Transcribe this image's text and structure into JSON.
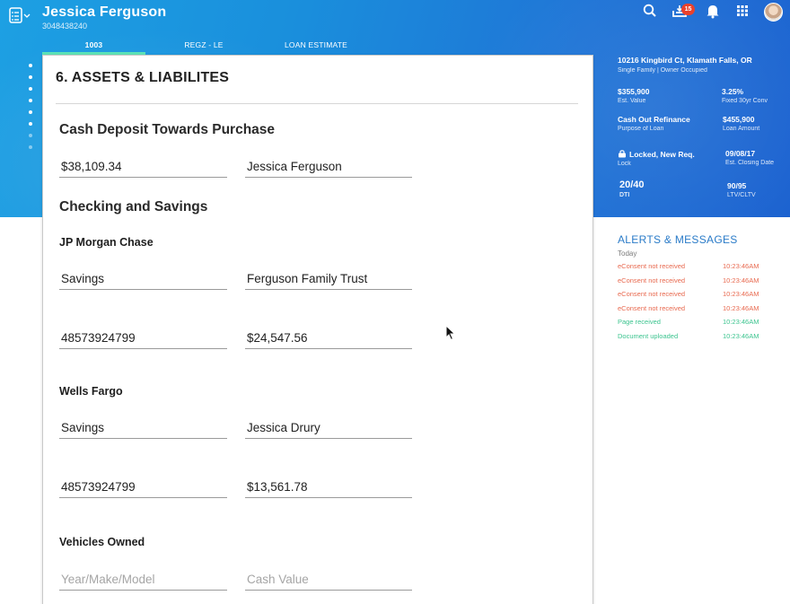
{
  "header": {
    "user_name": "Jessica Ferguson",
    "user_id": "3048438240",
    "notification_count": "15",
    "tabs": [
      {
        "label": "1003",
        "active": true
      },
      {
        "label": "REGZ - LE",
        "active": false
      },
      {
        "label": "LOAN ESTIMATE",
        "active": false
      }
    ],
    "icons": [
      "checklist-menu-icon",
      "search-icon",
      "inbox-download-icon",
      "bell-icon",
      "apps-grid-icon",
      "avatar"
    ]
  },
  "summary": {
    "address": "10216 Kingbird Ct, Klamath Falls, OR",
    "property_type": "Single Family | Owner Occupied",
    "est_value": {
      "value": "$355,900",
      "label": "Est. Value"
    },
    "rate": {
      "value": "3.25%",
      "label": "Fixed 30yr Conv"
    },
    "purpose": {
      "value": "Cash Out Refinance",
      "label": "Purpose of Loan"
    },
    "loan_amount": {
      "value": "$455,900",
      "label": "Loan Amount"
    },
    "lock": {
      "value": "Locked, New Req.",
      "label": "Lock"
    },
    "closing_date": {
      "value": "09/08/17",
      "label": "Est. Closing Date"
    },
    "dti": {
      "value": "20/40",
      "label": "DTI"
    },
    "ltv": {
      "value": "90/95",
      "label": "LTV/CLTV"
    }
  },
  "form": {
    "section_title": "6. ASSETS & LIABILITES",
    "cash_deposit": {
      "heading": "Cash Deposit Towards Purchase",
      "amount": "$38,109.34",
      "holder": "Jessica Ferguson"
    },
    "checking_savings": {
      "heading": "Checking and Savings",
      "accounts": [
        {
          "bank": "JP Morgan Chase",
          "type": "Savings",
          "holder": "Ferguson Family Trust",
          "number": "48573924799",
          "balance": "$24,547.56"
        },
        {
          "bank": "Wells Fargo",
          "type": "Savings",
          "holder": "Jessica Drury",
          "number": "48573924799",
          "balance": "$13,561.78"
        }
      ]
    },
    "vehicles": {
      "heading": "Vehicles Owned",
      "model_placeholder": "Year/Make/Model",
      "value_placeholder": "Cash Value"
    }
  },
  "alerts": {
    "title": "ALERTS & MESSAGES",
    "group": "Today",
    "items": [
      {
        "text": "eConsent not received",
        "time": "10:23:46AM",
        "status": "error",
        "color": "#e8694f"
      },
      {
        "text": "eConsent not received",
        "time": "10:23:46AM",
        "status": "error",
        "color": "#e8694f"
      },
      {
        "text": "eConsent not received",
        "time": "10:23:46AM",
        "status": "error",
        "color": "#e8694f"
      },
      {
        "text": "eConsent not received",
        "time": "10:23:46AM",
        "status": "error",
        "color": "#e8694f"
      },
      {
        "text": "Page received",
        "time": "10:23:46AM",
        "status": "success",
        "color": "#3cc48f"
      },
      {
        "text": "Document uploaded",
        "time": "10:23:46AM",
        "status": "success",
        "color": "#3cc48f"
      }
    ]
  },
  "colors": {
    "header_blue": "#1a8fdc",
    "active_tab_underline": "#5de3b7",
    "alert_title": "#2a7bc8",
    "badge": "#e8412c"
  }
}
